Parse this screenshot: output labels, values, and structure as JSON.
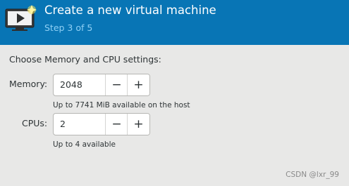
{
  "header": {
    "icon": "monitor-play-icon",
    "title": "Create a new virtual machine",
    "step": "Step 3 of 5"
  },
  "content": {
    "title": "Choose Memory and CPU settings:"
  },
  "memory": {
    "label": "Memory:",
    "value": "2048",
    "decrement_glyph": "−",
    "increment_glyph": "+",
    "hint": "Up to 7741 MiB available on the host"
  },
  "cpus": {
    "label": "CPUs:",
    "value": "2",
    "decrement_glyph": "−",
    "increment_glyph": "+",
    "hint": "Up to 4 available"
  },
  "watermark": "CSDN @lxr_99",
  "colors": {
    "header_bg": "#0875b5",
    "step_text": "#8fd0f5",
    "window_bg": "#e8e8e7"
  }
}
